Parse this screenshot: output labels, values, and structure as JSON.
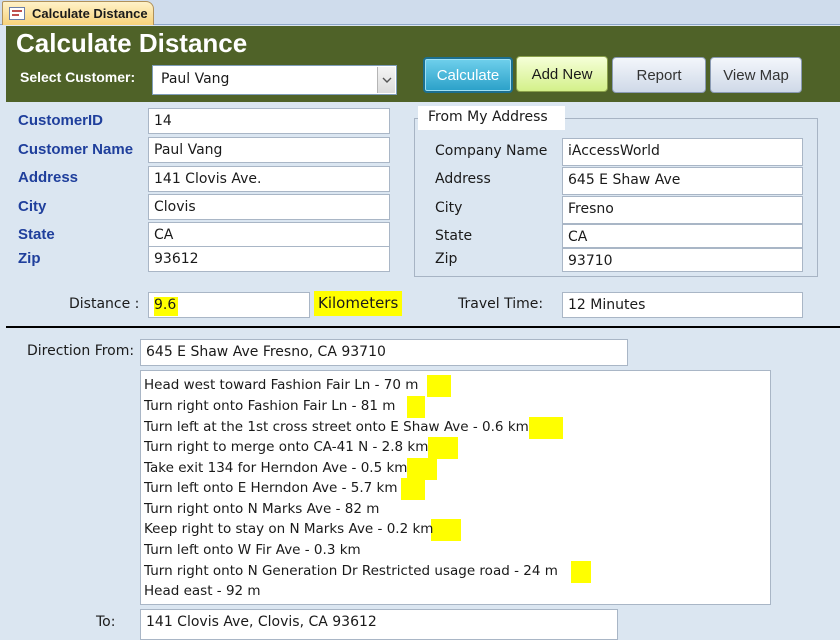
{
  "tab": {
    "title": "Calculate Distance",
    "icon": "form-icon"
  },
  "header": {
    "title": "Calculate Distance",
    "customer_label": "Select Customer:",
    "customer_value": "Paul Vang",
    "buttons": {
      "calculate": "Calculate",
      "add_new": "Add New",
      "report": "Report",
      "view_map": "View Map"
    }
  },
  "customer": {
    "id_label": "CustomerID",
    "id": "14",
    "name_label": "Customer Name",
    "name": "Paul Vang",
    "address_label": "Address",
    "address": "141 Clovis Ave.",
    "city_label": "City",
    "city": "Clovis",
    "state_label": "State",
    "state": "CA",
    "zip_label": "Zip",
    "zip": "93612"
  },
  "from": {
    "caption": "From My Address",
    "company_label": "Company Name",
    "company": "iAccessWorld",
    "address_label": "Address",
    "address": "645 E Shaw Ave",
    "city_label": "City",
    "city": "Fresno",
    "state_label": "State",
    "state": "CA",
    "zip_label": "Zip",
    "zip": "93710"
  },
  "distance": {
    "label": "Distance :",
    "value": "9.6",
    "units": "Kilometers",
    "travel_label": "Travel Time:",
    "travel_value": "12 Minutes"
  },
  "directions": {
    "from_label": "Direction From:",
    "from_value": "645 E Shaw Ave  Fresno,  CA 93710",
    "steps": [
      "Head  west  toward  Fashion Fair Ln  - 70 m",
      "Turn  right  onto  Fashion Fair Ln  - 81 m",
      "Turn  left  at the 1st cross street onto  E Shaw Ave  - 0.6 km",
      "Turn  right  to merge onto  CA-41 N  - 2.8 km",
      "Take exit  134  for  Herndon Ave  - 0.5 km",
      "Turn  left  onto  E Herndon Ave  - 5.7 km",
      "Turn  right  onto  N Marks Ave  - 82 m",
      "Keep  right  to stay on  N Marks Ave  - 0.2 km",
      "Turn  left  onto  W Fir Ave  - 0.3 km",
      "Turn  right  onto  N Generation Dr  Restricted usage road  - 24 m",
      "Head  east  - 92 m"
    ],
    "to_label": "To:",
    "to_value": "141 Clovis Ave,  Clovis,  CA 93612"
  },
  "colors": {
    "header_bg": "#4f6228",
    "label_blue": "#1f3f9c",
    "highlight": "#ffff00",
    "calculate_button": "#2aa0c8"
  }
}
